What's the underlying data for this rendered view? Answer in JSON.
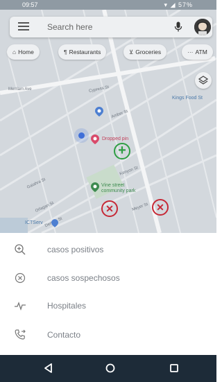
{
  "status_bar": {
    "time": "09:57",
    "right": "▾ ◢ 57%"
  },
  "search": {
    "placeholder": "Search here"
  },
  "chips": [
    {
      "label": "Home",
      "icon": "home-icon"
    },
    {
      "label": "Restaurants",
      "icon": "fork-knife-icon"
    },
    {
      "label": "Groceries",
      "icon": "cart-icon"
    },
    {
      "label": "ATM",
      "icon": "atm-icon"
    }
  ],
  "map": {
    "streets": [
      "Cypress St",
      "Amber St",
      "Kenyon St",
      "Gaiahra St",
      "Orlagan St",
      "Denton St",
      "Meyer St"
    ],
    "pois": {
      "kings_food": "Kings Food St",
      "dropped_pin": "Dropped pin",
      "vine_park_line1": "Vine street",
      "vine_park_line2": "community park",
      "ictserv": "ICTServ",
      "left_avenue": "Merriam Ave"
    }
  },
  "menu": [
    {
      "label": "casos positivos",
      "icon": "zoom-in-icon"
    },
    {
      "label": "casos sospechosos",
      "icon": "cancel-circle-icon"
    },
    {
      "label": "Hospitales",
      "icon": "heartbeat-icon"
    },
    {
      "label": "Contacto",
      "icon": "phone-forward-icon"
    }
  ],
  "colors": {
    "positive": "#2e9e43",
    "suspect": "#c62835",
    "nav_bar": "#1d2b38"
  }
}
